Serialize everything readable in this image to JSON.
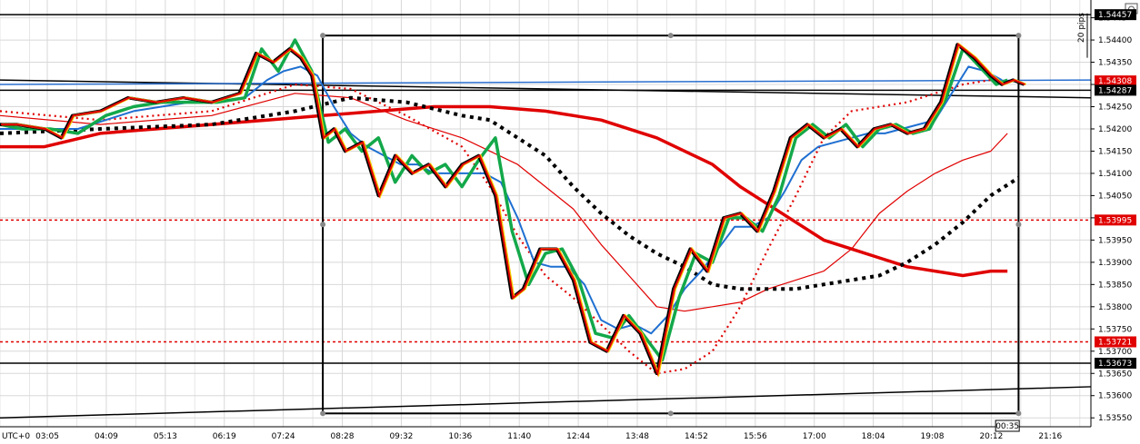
{
  "chart_data": {
    "type": "line",
    "timezone_label": "UTC+0",
    "x_ticks": [
      "03:05",
      "04:09",
      "05:13",
      "06:19",
      "07:24",
      "08:28",
      "09:32",
      "10:36",
      "11:40",
      "12:44",
      "13:48",
      "14:52",
      "15:56",
      "17:00",
      "18:04",
      "19:08",
      "20:12",
      "21:16"
    ],
    "cursor_time": "00:35",
    "y_ticks": [
      1.5355,
      1.536,
      1.5365,
      1.537,
      1.5375,
      1.538,
      1.5385,
      1.539,
      1.5395,
      1.54,
      1.5405,
      1.541,
      1.5415,
      1.542,
      1.5425,
      1.543,
      1.5435,
      1.544,
      1.5445
    ],
    "y_tick_labels": [
      "1.53550",
      "1.53600",
      "1.53650",
      "1.53700",
      "1.53750",
      "1.53800",
      "1.53850",
      "1.53900",
      "1.53950",
      "1.54000",
      "1.54050",
      "1.54100",
      "1.54150",
      "1.54200",
      "1.54250",
      "1.54300",
      "1.54350",
      "1.54400",
      "1.5445"
    ],
    "ylim": [
      1.5353,
      1.5449
    ],
    "xlim": [
      2.2,
      21.8
    ],
    "pips_label": "20 pips",
    "price_tags": [
      {
        "label": "1.54457",
        "value": 1.54457,
        "kind": "black"
      },
      {
        "label": "1.54308",
        "value": 1.54308,
        "kind": "red"
      },
      {
        "label": "1.54287",
        "value": 1.54287,
        "kind": "black"
      },
      {
        "label": "1.53995",
        "value": 1.53995,
        "kind": "red"
      },
      {
        "label": "1.53721",
        "value": 1.53721,
        "kind": "red"
      },
      {
        "label": "1.53673",
        "value": 1.53673,
        "kind": "black"
      }
    ],
    "h_lines": [
      {
        "value": 1.54457,
        "color": "#000000",
        "dash": "solid"
      },
      {
        "value": 1.54287,
        "color": "#000000",
        "dash": "solid"
      },
      {
        "value": 1.53995,
        "color": "#e00000",
        "dash": "dotted"
      },
      {
        "value": 1.53721,
        "color": "#e00000",
        "dash": "dotted"
      },
      {
        "value": 1.53673,
        "color": "#000000",
        "dash": "solid"
      }
    ],
    "trend_lines": [
      {
        "x": [
          2.2,
          21.8
        ],
        "y": [
          1.5431,
          1.5427
        ],
        "color": "#000000"
      },
      {
        "x": [
          2.2,
          21.8
        ],
        "y": [
          1.543,
          1.5431
        ],
        "color": "#2a6fcf"
      },
      {
        "x": [
          2.2,
          21.8
        ],
        "y": [
          1.5355,
          1.5362
        ],
        "color": "#000000"
      }
    ],
    "box": {
      "x": [
        8.0,
        20.5
      ],
      "y": [
        1.5356,
        1.5441
      ]
    },
    "price": {
      "x": [
        2.2,
        2.5,
        3.0,
        3.3,
        3.5,
        4.0,
        4.5,
        5.0,
        5.5,
        6.0,
        6.5,
        6.8,
        7.1,
        7.4,
        7.6,
        7.8,
        8.0,
        8.2,
        8.4,
        8.7,
        9.0,
        9.3,
        9.6,
        9.9,
        10.2,
        10.5,
        10.8,
        11.1,
        11.4,
        11.6,
        11.9,
        12.2,
        12.5,
        12.8,
        13.1,
        13.4,
        13.7,
        14.0,
        14.3,
        14.6,
        14.9,
        15.2,
        15.5,
        15.8,
        16.1,
        16.4,
        16.7,
        17.0,
        17.3,
        17.6,
        17.9,
        18.2,
        18.5,
        18.8,
        19.1,
        19.4,
        19.7,
        20.0,
        20.2,
        20.4,
        20.6
      ],
      "y": [
        1.5421,
        1.5421,
        1.542,
        1.5418,
        1.5423,
        1.5424,
        1.5427,
        1.5426,
        1.5427,
        1.5426,
        1.5428,
        1.5437,
        1.5435,
        1.5438,
        1.5436,
        1.5432,
        1.5418,
        1.542,
        1.5415,
        1.5417,
        1.5405,
        1.5414,
        1.541,
        1.5412,
        1.5407,
        1.5412,
        1.5414,
        1.5405,
        1.5382,
        1.5384,
        1.5393,
        1.5393,
        1.5386,
        1.5372,
        1.537,
        1.5378,
        1.5374,
        1.5365,
        1.5384,
        1.5393,
        1.5388,
        1.54,
        1.5401,
        1.5397,
        1.5406,
        1.5418,
        1.5421,
        1.5418,
        1.542,
        1.5416,
        1.542,
        1.5421,
        1.5419,
        1.542,
        1.5426,
        1.5439,
        1.5436,
        1.5432,
        1.543,
        1.5431,
        1.543
      ]
    },
    "series": [
      {
        "color": "#e00000",
        "style": "thick",
        "values_x": [
          2.2,
          3.0,
          4.0,
          5.0,
          6.0,
          7.0,
          8.0,
          9.0,
          10.0,
          11.0,
          12.0,
          13.0,
          14.0,
          15.0,
          15.5,
          16.0,
          16.5,
          17.0,
          17.5,
          18.0,
          18.5,
          19.0,
          19.5,
          20.0,
          20.3
        ],
        "values": [
          1.5416,
          1.5416,
          1.5419,
          1.542,
          1.5421,
          1.5422,
          1.5423,
          1.5424,
          1.5425,
          1.5425,
          1.5424,
          1.5422,
          1.5418,
          1.5412,
          1.5407,
          1.5403,
          1.5399,
          1.5395,
          1.5393,
          1.5391,
          1.5389,
          1.5388,
          1.5387,
          1.5388,
          1.5388
        ]
      },
      {
        "color": "#e00000",
        "style": "thin",
        "values_x": [
          2.2,
          4.0,
          6.0,
          7.5,
          8.5,
          9.5,
          10.5,
          11.5,
          12.5,
          13.0,
          13.5,
          14.0,
          14.5,
          15.0,
          15.5,
          16.0,
          16.5,
          17.0,
          17.5,
          18.0,
          18.5,
          19.0,
          19.5,
          20.0,
          20.3
        ],
        "values": [
          1.5423,
          1.5421,
          1.5423,
          1.5428,
          1.5427,
          1.5422,
          1.5418,
          1.5412,
          1.5402,
          1.5394,
          1.5387,
          1.538,
          1.5379,
          1.538,
          1.5381,
          1.5384,
          1.5386,
          1.5388,
          1.5393,
          1.5401,
          1.5406,
          1.541,
          1.5413,
          1.5415,
          1.5419
        ]
      },
      {
        "color": "#e00000",
        "style": "dotted",
        "values_x": [
          2.2,
          4.0,
          6.0,
          7.5,
          8.5,
          9.5,
          10.5,
          11.0,
          11.5,
          12.0,
          12.5,
          13.0,
          13.5,
          14.0,
          14.5,
          15.0,
          15.5,
          16.0,
          16.5,
          17.0,
          17.5,
          18.0,
          18.5,
          19.0,
          19.5,
          20.0
        ],
        "values": [
          1.5424,
          1.5422,
          1.5424,
          1.543,
          1.5429,
          1.5423,
          1.5416,
          1.5407,
          1.5396,
          1.5387,
          1.5382,
          1.5376,
          1.537,
          1.5365,
          1.5366,
          1.537,
          1.538,
          1.5393,
          1.5405,
          1.5418,
          1.5424,
          1.5425,
          1.5426,
          1.5428,
          1.543,
          1.5431
        ]
      },
      {
        "color": "#000000",
        "style": "dotted",
        "values_x": [
          2.2,
          4.0,
          6.0,
          7.5,
          8.5,
          9.5,
          10.5,
          11.0,
          11.5,
          12.0,
          12.5,
          13.0,
          13.5,
          14.0,
          14.5,
          15.0,
          15.5,
          16.0,
          16.5,
          17.0,
          17.5,
          18.0,
          18.5,
          19.0,
          19.5,
          20.0,
          20.5
        ],
        "values": [
          1.5419,
          1.542,
          1.5421,
          1.5424,
          1.5427,
          1.5426,
          1.5423,
          1.5422,
          1.5418,
          1.5414,
          1.5407,
          1.5401,
          1.5396,
          1.5392,
          1.5389,
          1.5385,
          1.5384,
          1.5384,
          1.5384,
          1.5385,
          1.5386,
          1.5387,
          1.539,
          1.5394,
          1.5399,
          1.5405,
          1.5409
        ]
      },
      {
        "color": "#1f6fd1",
        "style": "medium",
        "values_x": [
          2.2,
          2.6,
          3.1,
          3.6,
          4.1,
          4.6,
          5.1,
          5.6,
          6.1,
          6.6,
          7.0,
          7.3,
          7.6,
          7.9,
          8.2,
          8.5,
          8.8,
          9.1,
          9.4,
          9.7,
          10.0,
          10.3,
          10.6,
          10.9,
          11.2,
          11.5,
          11.8,
          12.1,
          12.4,
          12.7,
          13.0,
          13.3,
          13.6,
          13.9,
          14.2,
          14.5,
          14.8,
          15.1,
          15.4,
          15.7,
          16.0,
          16.3,
          16.6,
          16.9,
          17.2,
          17.5,
          17.8,
          18.1,
          18.4,
          18.7,
          19.0,
          19.3,
          19.6,
          19.9,
          20.2
        ],
        "values": [
          1.542,
          1.542,
          1.542,
          1.542,
          1.5422,
          1.5424,
          1.5425,
          1.5426,
          1.5426,
          1.5427,
          1.5431,
          1.5433,
          1.5434,
          1.5432,
          1.5425,
          1.5419,
          1.5416,
          1.5414,
          1.5412,
          1.5412,
          1.541,
          1.541,
          1.541,
          1.541,
          1.5408,
          1.54,
          1.539,
          1.5389,
          1.5389,
          1.5385,
          1.5377,
          1.5375,
          1.5376,
          1.5374,
          1.5378,
          1.5384,
          1.5388,
          1.5393,
          1.5398,
          1.5398,
          1.54,
          1.5406,
          1.5413,
          1.5416,
          1.5417,
          1.5418,
          1.5419,
          1.5419,
          1.542,
          1.5421,
          1.5422,
          1.5428,
          1.5434,
          1.5433,
          1.5431
        ]
      },
      {
        "color": "#13a84a",
        "style": "thick",
        "values_x": [
          2.2,
          2.6,
          3.1,
          3.6,
          4.1,
          4.6,
          5.1,
          5.6,
          6.1,
          6.6,
          6.9,
          7.2,
          7.5,
          7.8,
          8.1,
          8.4,
          8.7,
          9.0,
          9.3,
          9.6,
          9.9,
          10.2,
          10.5,
          10.8,
          11.1,
          11.4,
          11.7,
          12.0,
          12.3,
          12.6,
          12.9,
          13.2,
          13.5,
          13.8,
          14.1,
          14.4,
          14.7,
          15.0,
          15.3,
          15.6,
          15.9,
          16.2,
          16.5,
          16.8,
          17.1,
          17.4,
          17.7,
          18.0,
          18.3,
          18.6,
          18.9,
          19.2,
          19.5,
          19.8,
          20.1,
          20.3
        ],
        "values": [
          1.5421,
          1.542,
          1.542,
          1.5419,
          1.5423,
          1.5425,
          1.5426,
          1.5426,
          1.5426,
          1.5427,
          1.5438,
          1.5433,
          1.544,
          1.5433,
          1.5417,
          1.542,
          1.5415,
          1.5418,
          1.5408,
          1.5414,
          1.541,
          1.5412,
          1.5407,
          1.5413,
          1.5418,
          1.5397,
          1.5385,
          1.5392,
          1.5393,
          1.5386,
          1.5374,
          1.5373,
          1.5378,
          1.5373,
          1.5368,
          1.5382,
          1.5392,
          1.539,
          1.54,
          1.54,
          1.5397,
          1.5405,
          1.5418,
          1.5421,
          1.5418,
          1.5421,
          1.5416,
          1.542,
          1.5421,
          1.5419,
          1.542,
          1.5427,
          1.5438,
          1.5434,
          1.543,
          1.5431
        ]
      }
    ]
  }
}
